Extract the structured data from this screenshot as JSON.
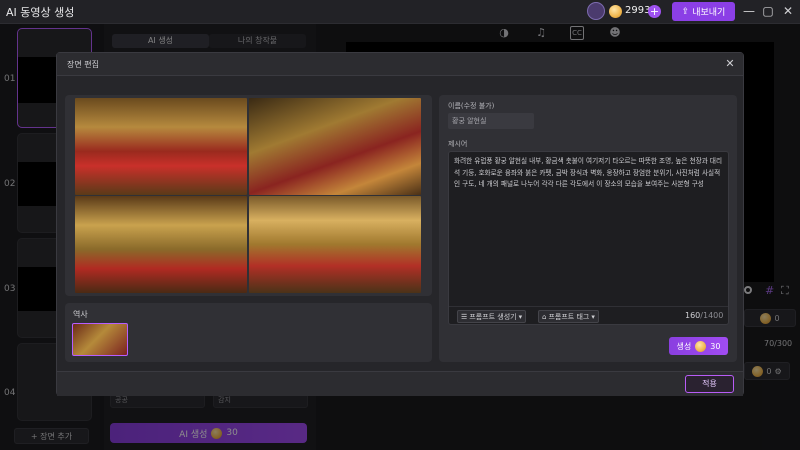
{
  "app": {
    "title": "AI 동영상 생성",
    "credits": "2993",
    "export_label": "내보내기"
  },
  "scenes": [
    {
      "num": "01"
    },
    {
      "num": "02"
    },
    {
      "num": "03"
    },
    {
      "num": "04"
    }
  ],
  "add_scene_label": "+ 장면 추가",
  "mid": {
    "tab_ai": "AI 생성",
    "tab_mine": "나의 창작물",
    "field_a": "공공",
    "field_b": "감지",
    "generate_label": "AI 생성",
    "generate_cost": "30"
  },
  "right": {
    "side_cost_1": "0",
    "side_count": "70/300",
    "side_cost_2": "0"
  },
  "dialog": {
    "title": "장면 편집",
    "history_label": "역사",
    "name_label": "이름(수정 불가)",
    "name_value": "황궁 알현실",
    "prompt_label": "제시어",
    "prompt_text": "화려한 유럽풍 황궁 알현실 내부, 황금색 촛불이 여기저기 타오르는 따뜻한 조명, 높은 천장과 대리석 기둥, 호화로운 융좌와 붉은 카펫, 금박 장식과 벽화, 웅장하고 장엄한 분위기, 사진처럼 사실적인 구도, 네 개의 패널로 나누어 각각 다른 각도에서 이 장소의 모습을 보여주는 사본형 구성",
    "prompt_generator": "프롬프트 생성기",
    "prompt_tag": "프롬프트 태그",
    "char_count": "160",
    "char_max": "/1400",
    "generate_label": "생성",
    "generate_cost": "30",
    "apply_label": "적용"
  },
  "colors": {
    "accent": "#8b3fe6",
    "bg": "#1b1b1e",
    "panel": "#303035"
  },
  "icons": [
    "user-voice-icon",
    "music-icon",
    "cc-icon",
    "sticker-icon",
    "coin-icon",
    "upload-icon",
    "close-icon"
  ]
}
